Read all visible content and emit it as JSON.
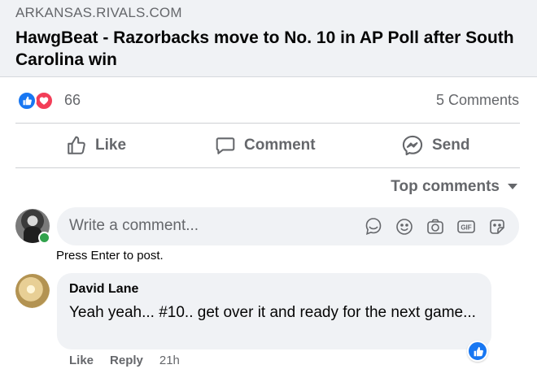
{
  "link": {
    "domain": "ARKANSAS.RIVALS.COM",
    "title": "HawgBeat - Razorbacks move to No. 10 in AP Poll after South Carolina win"
  },
  "reactions": {
    "types": [
      "like",
      "love"
    ],
    "count": "66",
    "comments_count": "5 Comments"
  },
  "actions": {
    "like": "Like",
    "comment": "Comment",
    "send": "Send"
  },
  "sort": {
    "label": "Top comments",
    "icon": "caret-down-icon"
  },
  "composer": {
    "placeholder": "Write a comment...",
    "hint": "Press Enter to post.",
    "icons": [
      "avatar-sticker-icon",
      "emoji-icon",
      "camera-icon",
      "gif-icon",
      "sticker-icon"
    ],
    "online": true
  },
  "comments": [
    {
      "author": "David Lane",
      "text": "Yeah yeah... #10.. get over it and ready for the next game...",
      "reaction": "like",
      "like_label": "Like",
      "reply_label": "Reply",
      "time": "21h"
    }
  ],
  "colors": {
    "facebook_blue": "#1877f2",
    "love_red": "#f33e58",
    "online_green": "#31a24c",
    "secondary_text": "#65676b",
    "bubble_bg": "#f0f2f5"
  }
}
